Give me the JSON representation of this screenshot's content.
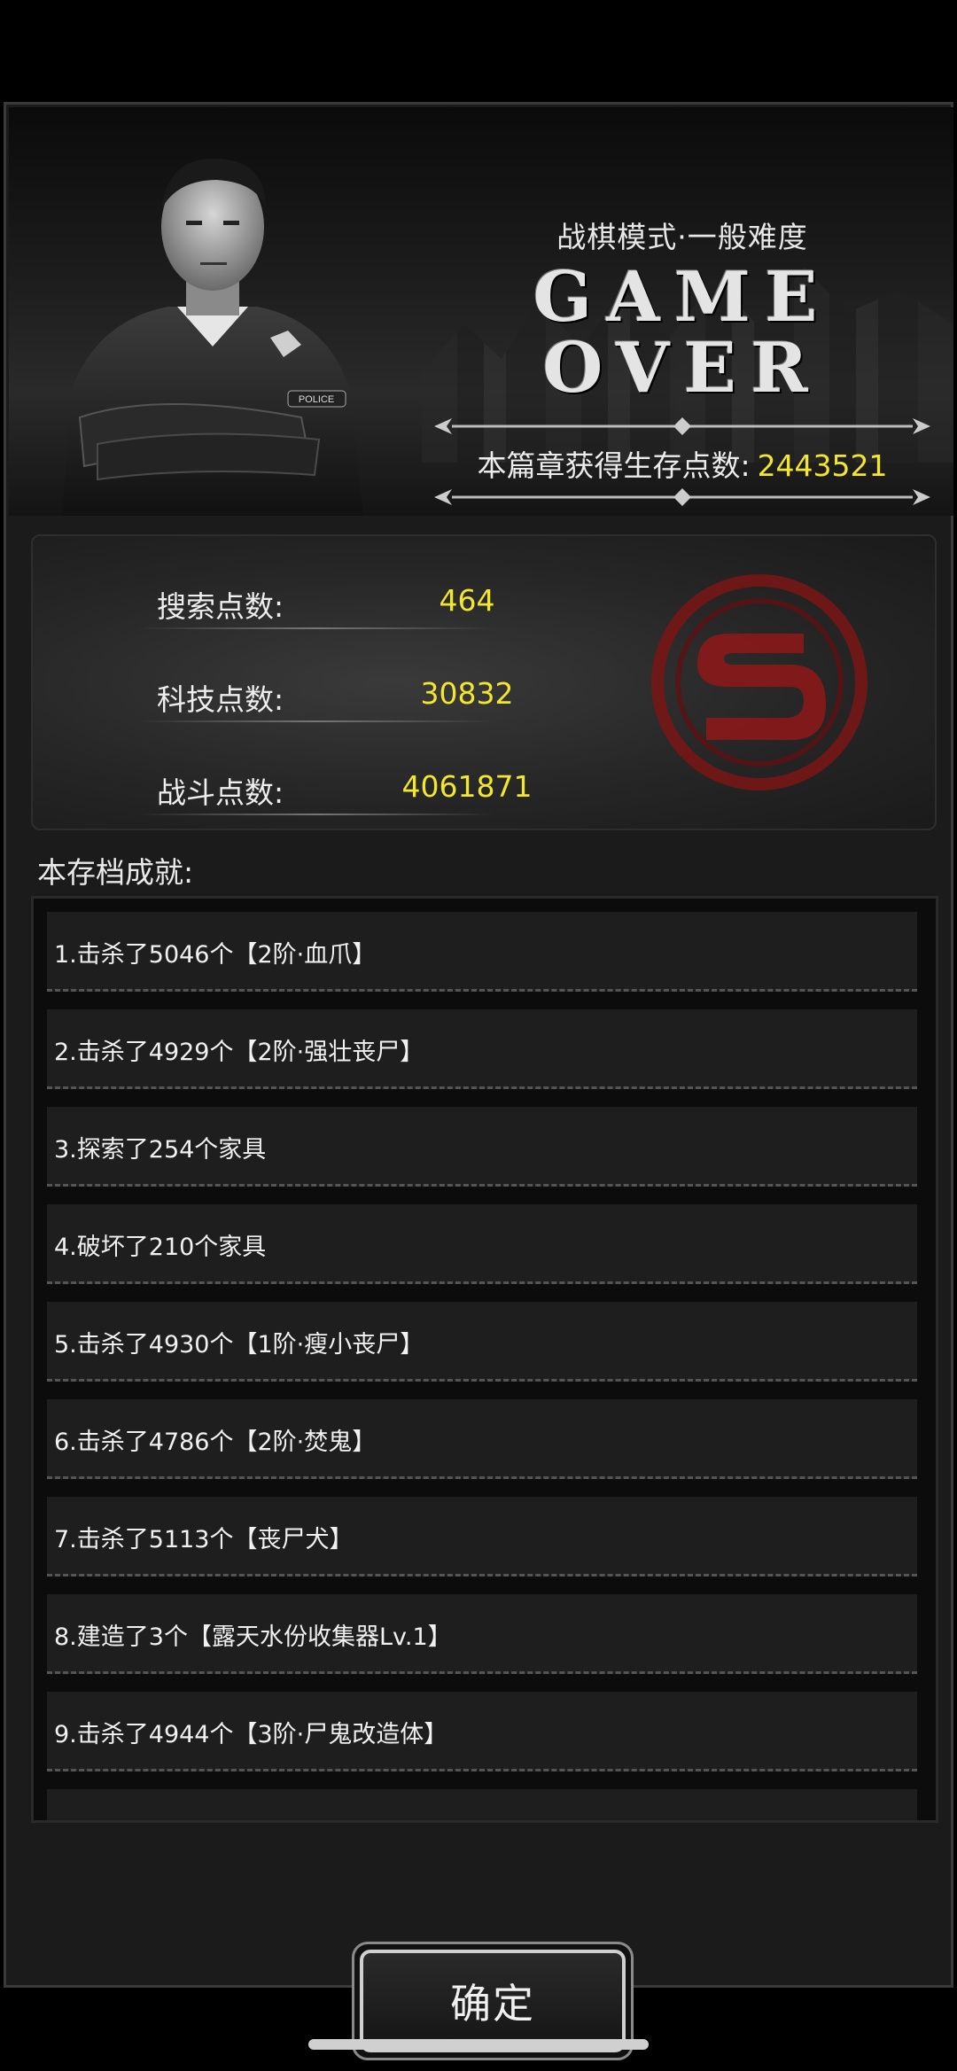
{
  "header": {
    "mode": "战棋模式·一般难度",
    "title_line1": "GAME",
    "title_line2": "OVER",
    "points_label": "本篇章获得生存点数:",
    "points_value": "2443521"
  },
  "stats": {
    "search_label": "搜索点数:",
    "search_value": "464",
    "tech_label": "科技点数:",
    "tech_value": "30832",
    "combat_label": "战斗点数:",
    "combat_value": "4061871"
  },
  "achievements": {
    "title": "本存档成就:",
    "items": [
      "1.击杀了5046个【2阶·血爪】",
      "2.击杀了4929个【2阶·强壮丧尸】",
      "3.探索了254个家具",
      "4.破坏了210个家具",
      "5.击杀了4930个【1阶·瘦小丧尸】",
      "6.击杀了4786个【2阶·焚鬼】",
      "7.击杀了5113个【丧尸犬】",
      "8.建造了3个【露天水份收集器Lv.1】",
      "9.击杀了4944个【3阶·尸鬼改造体】"
    ]
  },
  "confirm_label": "确定",
  "colors": {
    "accent_yellow": "#f3e62f",
    "badge_red": "#8b1a1a"
  }
}
